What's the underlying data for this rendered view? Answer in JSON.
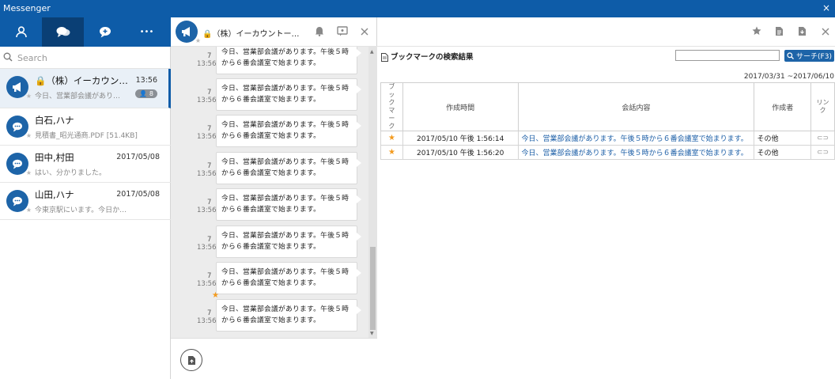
{
  "window": {
    "title": "Messenger",
    "close": "×"
  },
  "nav": {
    "tabs": [
      {
        "name": "contacts"
      },
      {
        "name": "chats",
        "active": true
      },
      {
        "name": "new-message"
      },
      {
        "name": "more",
        "label": "•••"
      }
    ]
  },
  "search": {
    "placeholder": "Search"
  },
  "conversations": [
    {
      "name": "（株）イーカウン…",
      "locked": true,
      "time": "13:56",
      "preview": "今日、営業部会議があり…",
      "member_badge": "8",
      "selected": true
    },
    {
      "name": "白石,ハナ",
      "time": "",
      "preview": "見積書_昭光通商.PDF [51.4KB]"
    },
    {
      "name": "田中,村田",
      "time": "2017/05/08",
      "preview": "はい、分かりました。"
    },
    {
      "name": "山田,ハナ",
      "time": "2017/05/08",
      "preview": "今東京駅にいます。今日か…"
    }
  ],
  "chat": {
    "title": "（株）イーカウントー…",
    "messages": [
      {
        "count": "7",
        "time": "13:56",
        "text": "今日、営業部会議があります。午後５時から６番会議室で始まります。"
      },
      {
        "count": "7",
        "time": "13:56",
        "text": "今日、営業部会議があります。午後５時から６番会議室で始まります。"
      },
      {
        "count": "7",
        "time": "13:56",
        "text": "今日、営業部会議があります。午後５時から６番会議室で始まります。"
      },
      {
        "count": "7",
        "time": "13:56",
        "text": "今日、営業部会議があります。午後５時から６番会議室で始まります。"
      },
      {
        "count": "7",
        "time": "13:56",
        "text": "今日、営業部会議があります。午後５時から６番会議室で始まります。"
      },
      {
        "count": "7",
        "time": "13:56",
        "text": "今日、営業部会議があります。午後５時から６番会議室で始まります。"
      },
      {
        "count": "7",
        "time": "13:56",
        "text": "今日、営業部会議があります。午後５時から６番会議室で始まります。"
      },
      {
        "count": "7",
        "time": "13:56",
        "text": "今日、営業部会議があります。午後５時から６番会議室で始まります。",
        "starred": true
      }
    ]
  },
  "bookmarks": {
    "title": "ブックマークの検索結果",
    "search_value": "",
    "search_button": "サーチ(F3)",
    "date_range": "2017/03/31 ~2017/06/10",
    "columns": {
      "bookmark": "ブックマーク",
      "created": "作成時間",
      "content": "会話内容",
      "author": "作成者",
      "link": "リンク"
    },
    "rows": [
      {
        "created": "2017/05/10 午後 1:56:14",
        "content": "今日、営業部会議があります。午後５時から６番会議室で始まります。",
        "author": "その他"
      },
      {
        "created": "2017/05/10 午後 1:56:20",
        "content": "今日、営業部会議があります。午後５時から６番会議室で始まります。",
        "author": "その他"
      }
    ]
  },
  "colors": {
    "brand": "#0e5ca8",
    "accent": "#1d64a8",
    "star": "#f39a1d",
    "lock": "#d83a3a"
  }
}
